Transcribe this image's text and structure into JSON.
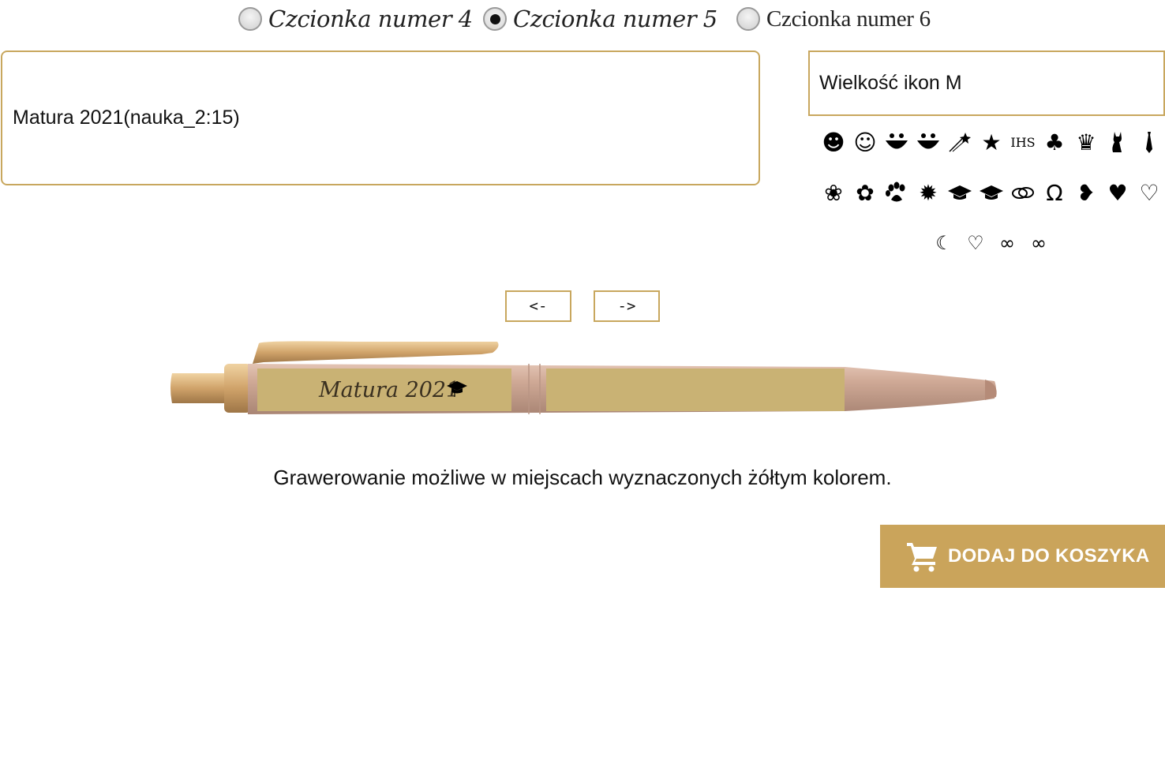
{
  "fonts": {
    "options": [
      {
        "label": "Czcionka numer 4",
        "selected": false
      },
      {
        "label": "Czcionka numer 5",
        "selected": true
      },
      {
        "label": "Czcionka numer 6",
        "selected": false
      }
    ]
  },
  "engraving": {
    "text_value": "Matura 2021(nauka_2:15)"
  },
  "icon_size": {
    "label": "Wielkość ikon M"
  },
  "icons": {
    "row1": [
      {
        "name": "smiley-face-icon",
        "glyph": "☻"
      },
      {
        "name": "smiley-outline-icon",
        "glyph": "☺"
      },
      {
        "name": "grin-face-icon",
        "glyph": "◡"
      },
      {
        "name": "grin-face-2-icon",
        "glyph": "◡"
      },
      {
        "name": "shooting-stars-icon",
        "glyph": "✨"
      },
      {
        "name": "star-icon",
        "glyph": "★"
      },
      {
        "name": "ihs-icon",
        "glyph": "IHS"
      },
      {
        "name": "clover-icon",
        "glyph": "♣"
      },
      {
        "name": "crown-icon",
        "glyph": "♛"
      },
      {
        "name": "cat-icon",
        "glyph": "🐈"
      },
      {
        "name": "tie-icon",
        "glyph": "▾"
      }
    ],
    "row2": [
      {
        "name": "rose-icon",
        "glyph": "❀"
      },
      {
        "name": "rosebud-icon",
        "glyph": "✿"
      },
      {
        "name": "paw-icon",
        "glyph": "🐾"
      },
      {
        "name": "rosette-icon",
        "glyph": "✹"
      },
      {
        "name": "graduation-cap-icon",
        "glyph": "🎓"
      },
      {
        "name": "graduation-cap-2-icon",
        "glyph": "🎓"
      },
      {
        "name": "rings-icon",
        "glyph": "⚭"
      },
      {
        "name": "horseshoe-icon",
        "glyph": "Ω"
      },
      {
        "name": "heart-half-icon",
        "glyph": "❥"
      },
      {
        "name": "heart-solid-icon",
        "glyph": "♥"
      },
      {
        "name": "heart-outline-icon",
        "glyph": "♡"
      }
    ],
    "row3": [
      {
        "name": "heart-swirl-icon",
        "glyph": "☾"
      },
      {
        "name": "double-heart-icon",
        "glyph": "♡"
      },
      {
        "name": "infinity-icon",
        "glyph": "∞"
      },
      {
        "name": "infinity-2-icon",
        "glyph": "∞"
      }
    ]
  },
  "navigation": {
    "prev_label": "<-",
    "next_label": "->"
  },
  "pen": {
    "engraved_text": "Matura 2021",
    "body_color": "#caa895",
    "engrave_area_color": "#c9b274",
    "trim_color": "#c89b5c"
  },
  "hint": {
    "text": "Grawerowanie możliwe w miejscach wyznaczonych żółtym kolorem."
  },
  "cart": {
    "label": "DODAJ DO KOSZYKA",
    "icon": "shopping-cart-icon"
  },
  "colors": {
    "accent": "#caa45b",
    "border": "#c8a75e"
  }
}
